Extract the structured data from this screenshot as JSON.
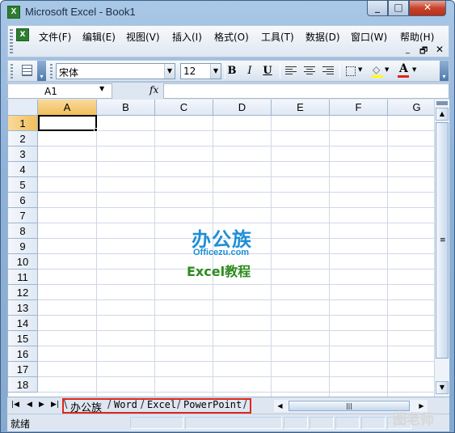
{
  "window": {
    "title": "Microsoft Excel - Book1",
    "minimize": "_",
    "maximize": "□",
    "close": "✕"
  },
  "menu": {
    "items": [
      "文件(F)",
      "编辑(E)",
      "视图(V)",
      "插入(I)",
      "格式(O)",
      "工具(T)",
      "数据(D)",
      "窗口(W)",
      "帮助(H)"
    ],
    "doc_min": "_",
    "doc_restore": "🗗",
    "doc_close": "✕"
  },
  "toolbar": {
    "font": "宋体",
    "size": "12",
    "bold": "B",
    "italic": "I",
    "underline": "U",
    "font_color_label": "A"
  },
  "formula_bar": {
    "name_box": "A1",
    "fx": "fx",
    "formula": ""
  },
  "grid": {
    "columns": [
      "A",
      "B",
      "C",
      "D",
      "E",
      "F",
      "G"
    ],
    "rows": [
      "1",
      "2",
      "3",
      "4",
      "5",
      "6",
      "7",
      "8",
      "9",
      "10",
      "11",
      "12",
      "13",
      "14",
      "15",
      "16",
      "17",
      "18"
    ],
    "active_cell": "A1"
  },
  "sheets": {
    "tabs": [
      "办公族",
      "Word",
      "Excel",
      "PowerPoint"
    ],
    "active": "办公族"
  },
  "status": {
    "text": "就绪"
  },
  "watermark": {
    "logo_cn": "办公族",
    "logo_site": "Officezu.com",
    "logo_sub": "Excel教程",
    "corner": "图老师"
  },
  "colors": {
    "accent": "#1f8fd6",
    "active_header": "#f1c05c",
    "tab_highlight": "#e0261b",
    "logo_green": "#2e8b1f"
  }
}
